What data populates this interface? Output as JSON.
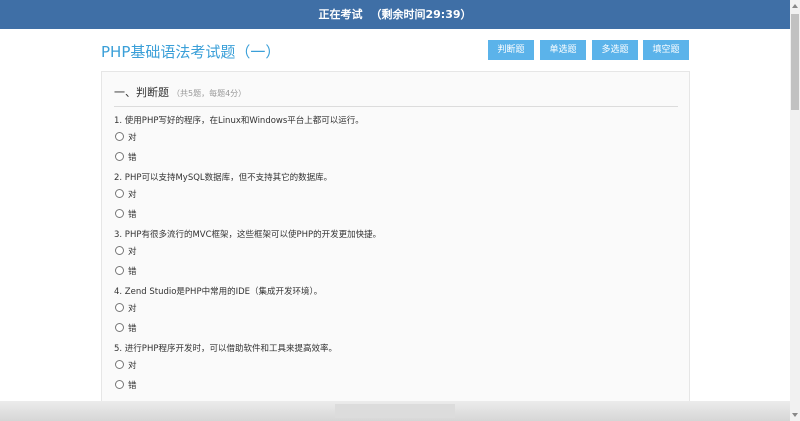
{
  "header": {
    "status": "正在考试",
    "remaining_prefix": "（剩余时间",
    "remaining_time": "29:39",
    "remaining_suffix": "）"
  },
  "page_title": "PHP基础语法考试题（一）",
  "question_types": [
    "判断题",
    "单选题",
    "多选题",
    "填空题"
  ],
  "section": {
    "title": "一、判断题",
    "note": "（共5题，每题4分）"
  },
  "questions": [
    {
      "text": "1. 使用PHP写好的程序，在Linux和Windows平台上都可以运行。",
      "options": [
        "对",
        "错"
      ]
    },
    {
      "text": "2. PHP可以支持MySQL数据库，但不支持其它的数据库。",
      "options": [
        "对",
        "错"
      ]
    },
    {
      "text": "3. PHP有很多流行的MVC框架，这些框架可以使PHP的开发更加快捷。",
      "options": [
        "对",
        "错"
      ]
    },
    {
      "text": "4. Zend Studio是PHP中常用的IDE（集成开发环境）。",
      "options": [
        "对",
        "错"
      ]
    },
    {
      "text": "5. 进行PHP程序开发时，可以借助软件和工具来提高效率。",
      "options": [
        "对",
        "错"
      ]
    }
  ],
  "colors": {
    "header_bg": "#3f6fa6",
    "title": "#3a9fd8",
    "button_bg": "#5bb3ea"
  }
}
